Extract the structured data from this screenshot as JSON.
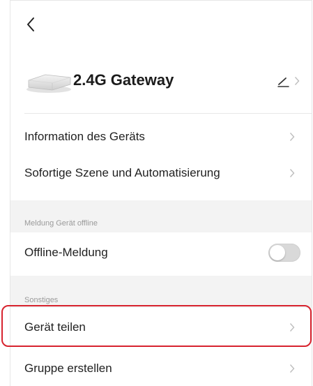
{
  "device": {
    "name": "2.4G Gateway"
  },
  "rows": {
    "info": "Information des Geräts",
    "scene": "Sofortige Szene und Automatisierung",
    "offline_section": "Meldung Gerät offline",
    "offline_toggle_label": "Offline-Meldung",
    "offline_toggle_state": "off",
    "other_section": "Sonstiges",
    "share": "Gerät teilen",
    "group": "Gruppe erstellen"
  },
  "colors": {
    "highlight": "#d7232e",
    "section_bg": "#f3f3f3",
    "chevron": "#bdbdbd",
    "toggle_off": "#d9d9d9"
  },
  "icons": {
    "back": "back-arrow-icon",
    "edit": "edit-pencil-icon",
    "chevron": "chevron-right-icon"
  }
}
